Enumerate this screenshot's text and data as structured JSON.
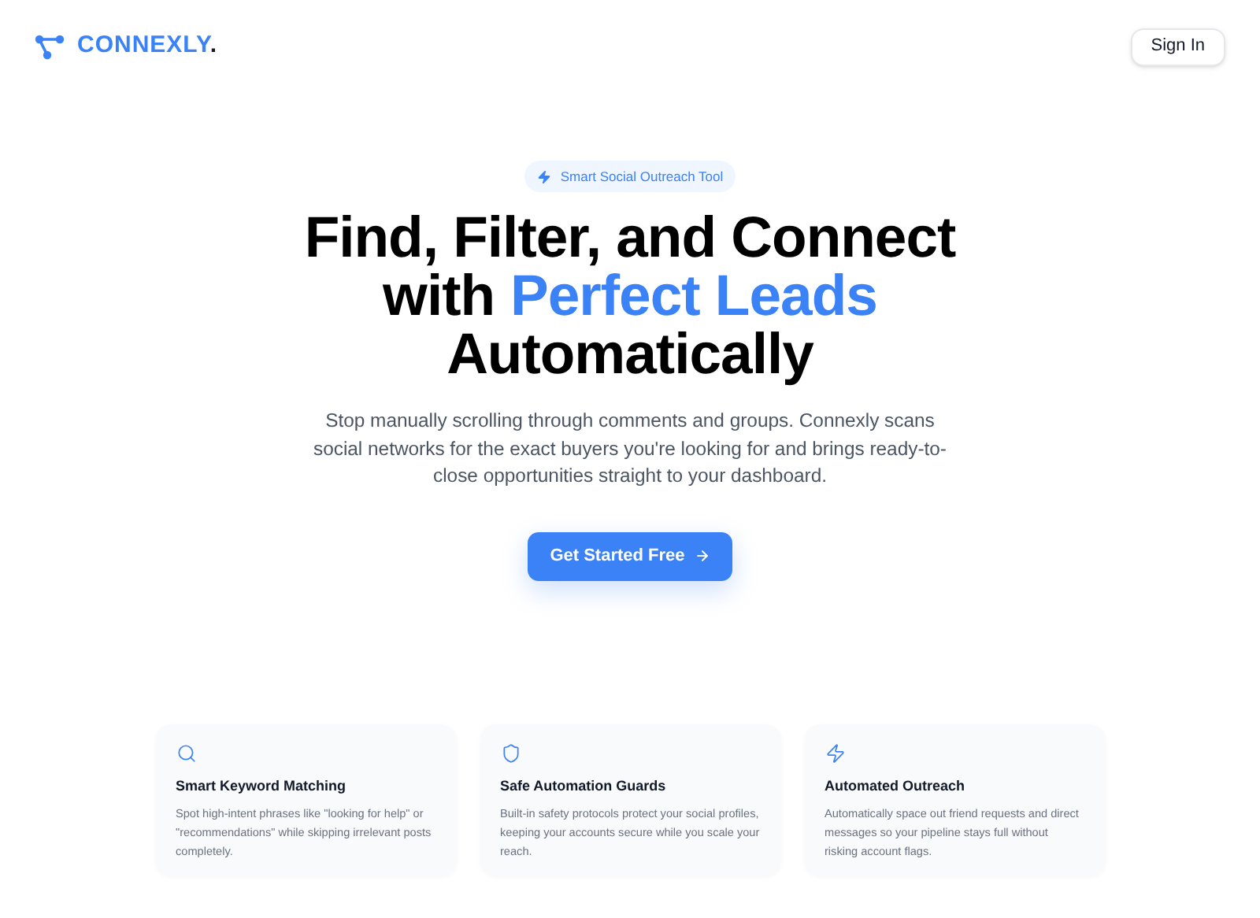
{
  "header": {
    "logo": {
      "name": "CONNEXLY",
      "dot": "."
    },
    "sign_in": "Sign In"
  },
  "hero": {
    "badge": "Smart Social Outreach Tool",
    "headline_lines": [
      [
        {
          "text": "Find, Filter, and Connect",
          "highlight": false
        }
      ],
      [
        {
          "text": "with",
          "highlight": false
        },
        {
          "text": "Perfect Leads",
          "highlight": true
        }
      ],
      [
        {
          "text": "Automatically",
          "highlight": false
        }
      ]
    ],
    "description": "Stop manually scrolling through comments and groups. Connexly scans social networks for the exact buyers you're looking for and brings ready-to-close opportunities straight to your dashboard.",
    "cta": "Get Started Free"
  },
  "features": [
    {
      "kind": "search",
      "title": "Smart Keyword Matching",
      "text": "Spot high-intent phrases like \"looking for help\" or \"recommendations\" while skipping irrelevant posts completely."
    },
    {
      "kind": "shield",
      "title": "Safe Automation Guards",
      "text": "Built-in safety protocols protect your social profiles, keeping your accounts secure while you scale your reach."
    },
    {
      "kind": "zap",
      "title": "Automated Outreach",
      "text": "Automatically space out friend requests and direct messages so your pipeline stays full without risking account flags."
    }
  ]
}
